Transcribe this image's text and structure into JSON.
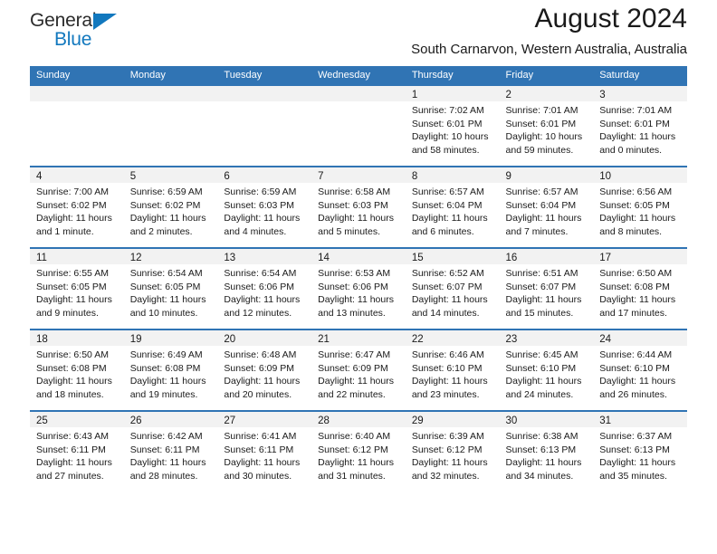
{
  "brand": {
    "name_top": "General",
    "name_bottom": "Blue",
    "triangle_icon": "triangle-icon",
    "accent_color": "#1278be"
  },
  "header": {
    "title": "August 2024",
    "subtitle": "South Carnarvon, Western Australia, Australia"
  },
  "theme": {
    "header_blue": "#3074b4",
    "band_gray": "#f2f2f2",
    "text": "#1a1a1a"
  },
  "calendar": {
    "weekday_headers": [
      "Sunday",
      "Monday",
      "Tuesday",
      "Wednesday",
      "Thursday",
      "Friday",
      "Saturday"
    ],
    "weeks": [
      [
        {
          "day": "",
          "lines": []
        },
        {
          "day": "",
          "lines": []
        },
        {
          "day": "",
          "lines": []
        },
        {
          "day": "",
          "lines": []
        },
        {
          "day": "1",
          "lines": [
            "Sunrise: 7:02 AM",
            "Sunset: 6:01 PM",
            "Daylight: 10 hours",
            "and 58 minutes."
          ]
        },
        {
          "day": "2",
          "lines": [
            "Sunrise: 7:01 AM",
            "Sunset: 6:01 PM",
            "Daylight: 10 hours",
            "and 59 minutes."
          ]
        },
        {
          "day": "3",
          "lines": [
            "Sunrise: 7:01 AM",
            "Sunset: 6:01 PM",
            "Daylight: 11 hours",
            "and 0 minutes."
          ]
        }
      ],
      [
        {
          "day": "4",
          "lines": [
            "Sunrise: 7:00 AM",
            "Sunset: 6:02 PM",
            "Daylight: 11 hours",
            "and 1 minute."
          ]
        },
        {
          "day": "5",
          "lines": [
            "Sunrise: 6:59 AM",
            "Sunset: 6:02 PM",
            "Daylight: 11 hours",
            "and 2 minutes."
          ]
        },
        {
          "day": "6",
          "lines": [
            "Sunrise: 6:59 AM",
            "Sunset: 6:03 PM",
            "Daylight: 11 hours",
            "and 4 minutes."
          ]
        },
        {
          "day": "7",
          "lines": [
            "Sunrise: 6:58 AM",
            "Sunset: 6:03 PM",
            "Daylight: 11 hours",
            "and 5 minutes."
          ]
        },
        {
          "day": "8",
          "lines": [
            "Sunrise: 6:57 AM",
            "Sunset: 6:04 PM",
            "Daylight: 11 hours",
            "and 6 minutes."
          ]
        },
        {
          "day": "9",
          "lines": [
            "Sunrise: 6:57 AM",
            "Sunset: 6:04 PM",
            "Daylight: 11 hours",
            "and 7 minutes."
          ]
        },
        {
          "day": "10",
          "lines": [
            "Sunrise: 6:56 AM",
            "Sunset: 6:05 PM",
            "Daylight: 11 hours",
            "and 8 minutes."
          ]
        }
      ],
      [
        {
          "day": "11",
          "lines": [
            "Sunrise: 6:55 AM",
            "Sunset: 6:05 PM",
            "Daylight: 11 hours",
            "and 9 minutes."
          ]
        },
        {
          "day": "12",
          "lines": [
            "Sunrise: 6:54 AM",
            "Sunset: 6:05 PM",
            "Daylight: 11 hours",
            "and 10 minutes."
          ]
        },
        {
          "day": "13",
          "lines": [
            "Sunrise: 6:54 AM",
            "Sunset: 6:06 PM",
            "Daylight: 11 hours",
            "and 12 minutes."
          ]
        },
        {
          "day": "14",
          "lines": [
            "Sunrise: 6:53 AM",
            "Sunset: 6:06 PM",
            "Daylight: 11 hours",
            "and 13 minutes."
          ]
        },
        {
          "day": "15",
          "lines": [
            "Sunrise: 6:52 AM",
            "Sunset: 6:07 PM",
            "Daylight: 11 hours",
            "and 14 minutes."
          ]
        },
        {
          "day": "16",
          "lines": [
            "Sunrise: 6:51 AM",
            "Sunset: 6:07 PM",
            "Daylight: 11 hours",
            "and 15 minutes."
          ]
        },
        {
          "day": "17",
          "lines": [
            "Sunrise: 6:50 AM",
            "Sunset: 6:08 PM",
            "Daylight: 11 hours",
            "and 17 minutes."
          ]
        }
      ],
      [
        {
          "day": "18",
          "lines": [
            "Sunrise: 6:50 AM",
            "Sunset: 6:08 PM",
            "Daylight: 11 hours",
            "and 18 minutes."
          ]
        },
        {
          "day": "19",
          "lines": [
            "Sunrise: 6:49 AM",
            "Sunset: 6:08 PM",
            "Daylight: 11 hours",
            "and 19 minutes."
          ]
        },
        {
          "day": "20",
          "lines": [
            "Sunrise: 6:48 AM",
            "Sunset: 6:09 PM",
            "Daylight: 11 hours",
            "and 20 minutes."
          ]
        },
        {
          "day": "21",
          "lines": [
            "Sunrise: 6:47 AM",
            "Sunset: 6:09 PM",
            "Daylight: 11 hours",
            "and 22 minutes."
          ]
        },
        {
          "day": "22",
          "lines": [
            "Sunrise: 6:46 AM",
            "Sunset: 6:10 PM",
            "Daylight: 11 hours",
            "and 23 minutes."
          ]
        },
        {
          "day": "23",
          "lines": [
            "Sunrise: 6:45 AM",
            "Sunset: 6:10 PM",
            "Daylight: 11 hours",
            "and 24 minutes."
          ]
        },
        {
          "day": "24",
          "lines": [
            "Sunrise: 6:44 AM",
            "Sunset: 6:10 PM",
            "Daylight: 11 hours",
            "and 26 minutes."
          ]
        }
      ],
      [
        {
          "day": "25",
          "lines": [
            "Sunrise: 6:43 AM",
            "Sunset: 6:11 PM",
            "Daylight: 11 hours",
            "and 27 minutes."
          ]
        },
        {
          "day": "26",
          "lines": [
            "Sunrise: 6:42 AM",
            "Sunset: 6:11 PM",
            "Daylight: 11 hours",
            "and 28 minutes."
          ]
        },
        {
          "day": "27",
          "lines": [
            "Sunrise: 6:41 AM",
            "Sunset: 6:11 PM",
            "Daylight: 11 hours",
            "and 30 minutes."
          ]
        },
        {
          "day": "28",
          "lines": [
            "Sunrise: 6:40 AM",
            "Sunset: 6:12 PM",
            "Daylight: 11 hours",
            "and 31 minutes."
          ]
        },
        {
          "day": "29",
          "lines": [
            "Sunrise: 6:39 AM",
            "Sunset: 6:12 PM",
            "Daylight: 11 hours",
            "and 32 minutes."
          ]
        },
        {
          "day": "30",
          "lines": [
            "Sunrise: 6:38 AM",
            "Sunset: 6:13 PM",
            "Daylight: 11 hours",
            "and 34 minutes."
          ]
        },
        {
          "day": "31",
          "lines": [
            "Sunrise: 6:37 AM",
            "Sunset: 6:13 PM",
            "Daylight: 11 hours",
            "and 35 minutes."
          ]
        }
      ]
    ]
  }
}
